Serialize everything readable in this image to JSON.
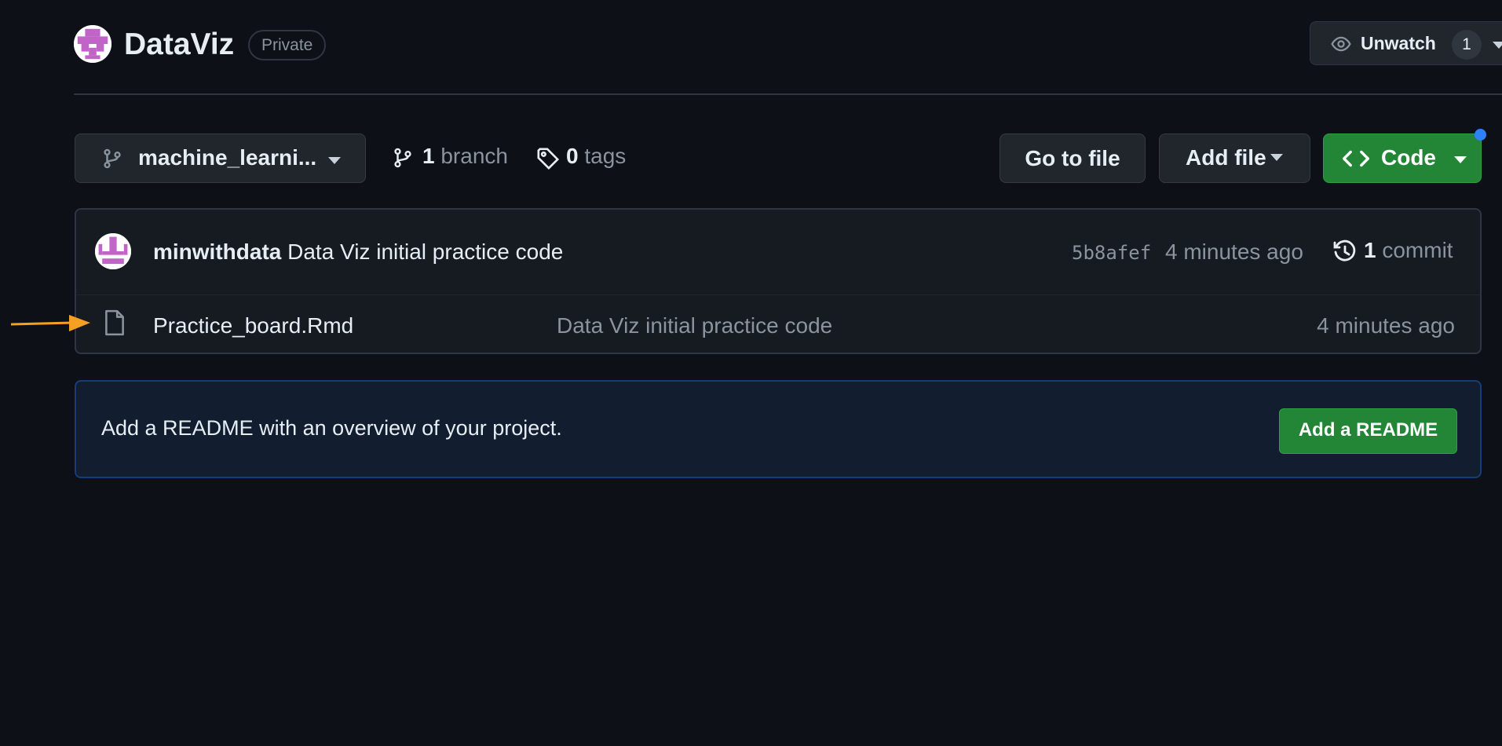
{
  "repo": {
    "name": "DataViz",
    "visibility": "Private"
  },
  "watch": {
    "label": "Unwatch",
    "count": "1"
  },
  "toolbar": {
    "branch_name": "machine_learni...",
    "branch_count": "1",
    "branch_label": "branch",
    "tag_count": "0",
    "tag_label": "tags",
    "go_to_file": "Go to file",
    "add_file": "Add file",
    "code": "Code"
  },
  "latest_commit": {
    "author": "minwithdata",
    "message": "Data Viz initial practice code",
    "sha": "5b8afef",
    "time": "4 minutes ago",
    "commit_count": "1",
    "commit_label": "commit"
  },
  "files": [
    {
      "name": "Practice_board.Rmd",
      "message": "Data Viz initial practice code",
      "time": "4 minutes ago"
    }
  ],
  "readme": {
    "prompt": "Add a README with an overview of your project.",
    "button": "Add a README"
  },
  "colors": {
    "background": "#0d1117",
    "primary_button": "#238636",
    "accent_dot": "#2f81f7",
    "annotation_arrow": "#f6a023",
    "avatar_purple": "#c164c8"
  },
  "icons": [
    "repo-avatar",
    "eye-icon",
    "git-branch-icon",
    "tag-icon",
    "code-icon",
    "history-icon",
    "file-icon",
    "annotation-arrow"
  ]
}
